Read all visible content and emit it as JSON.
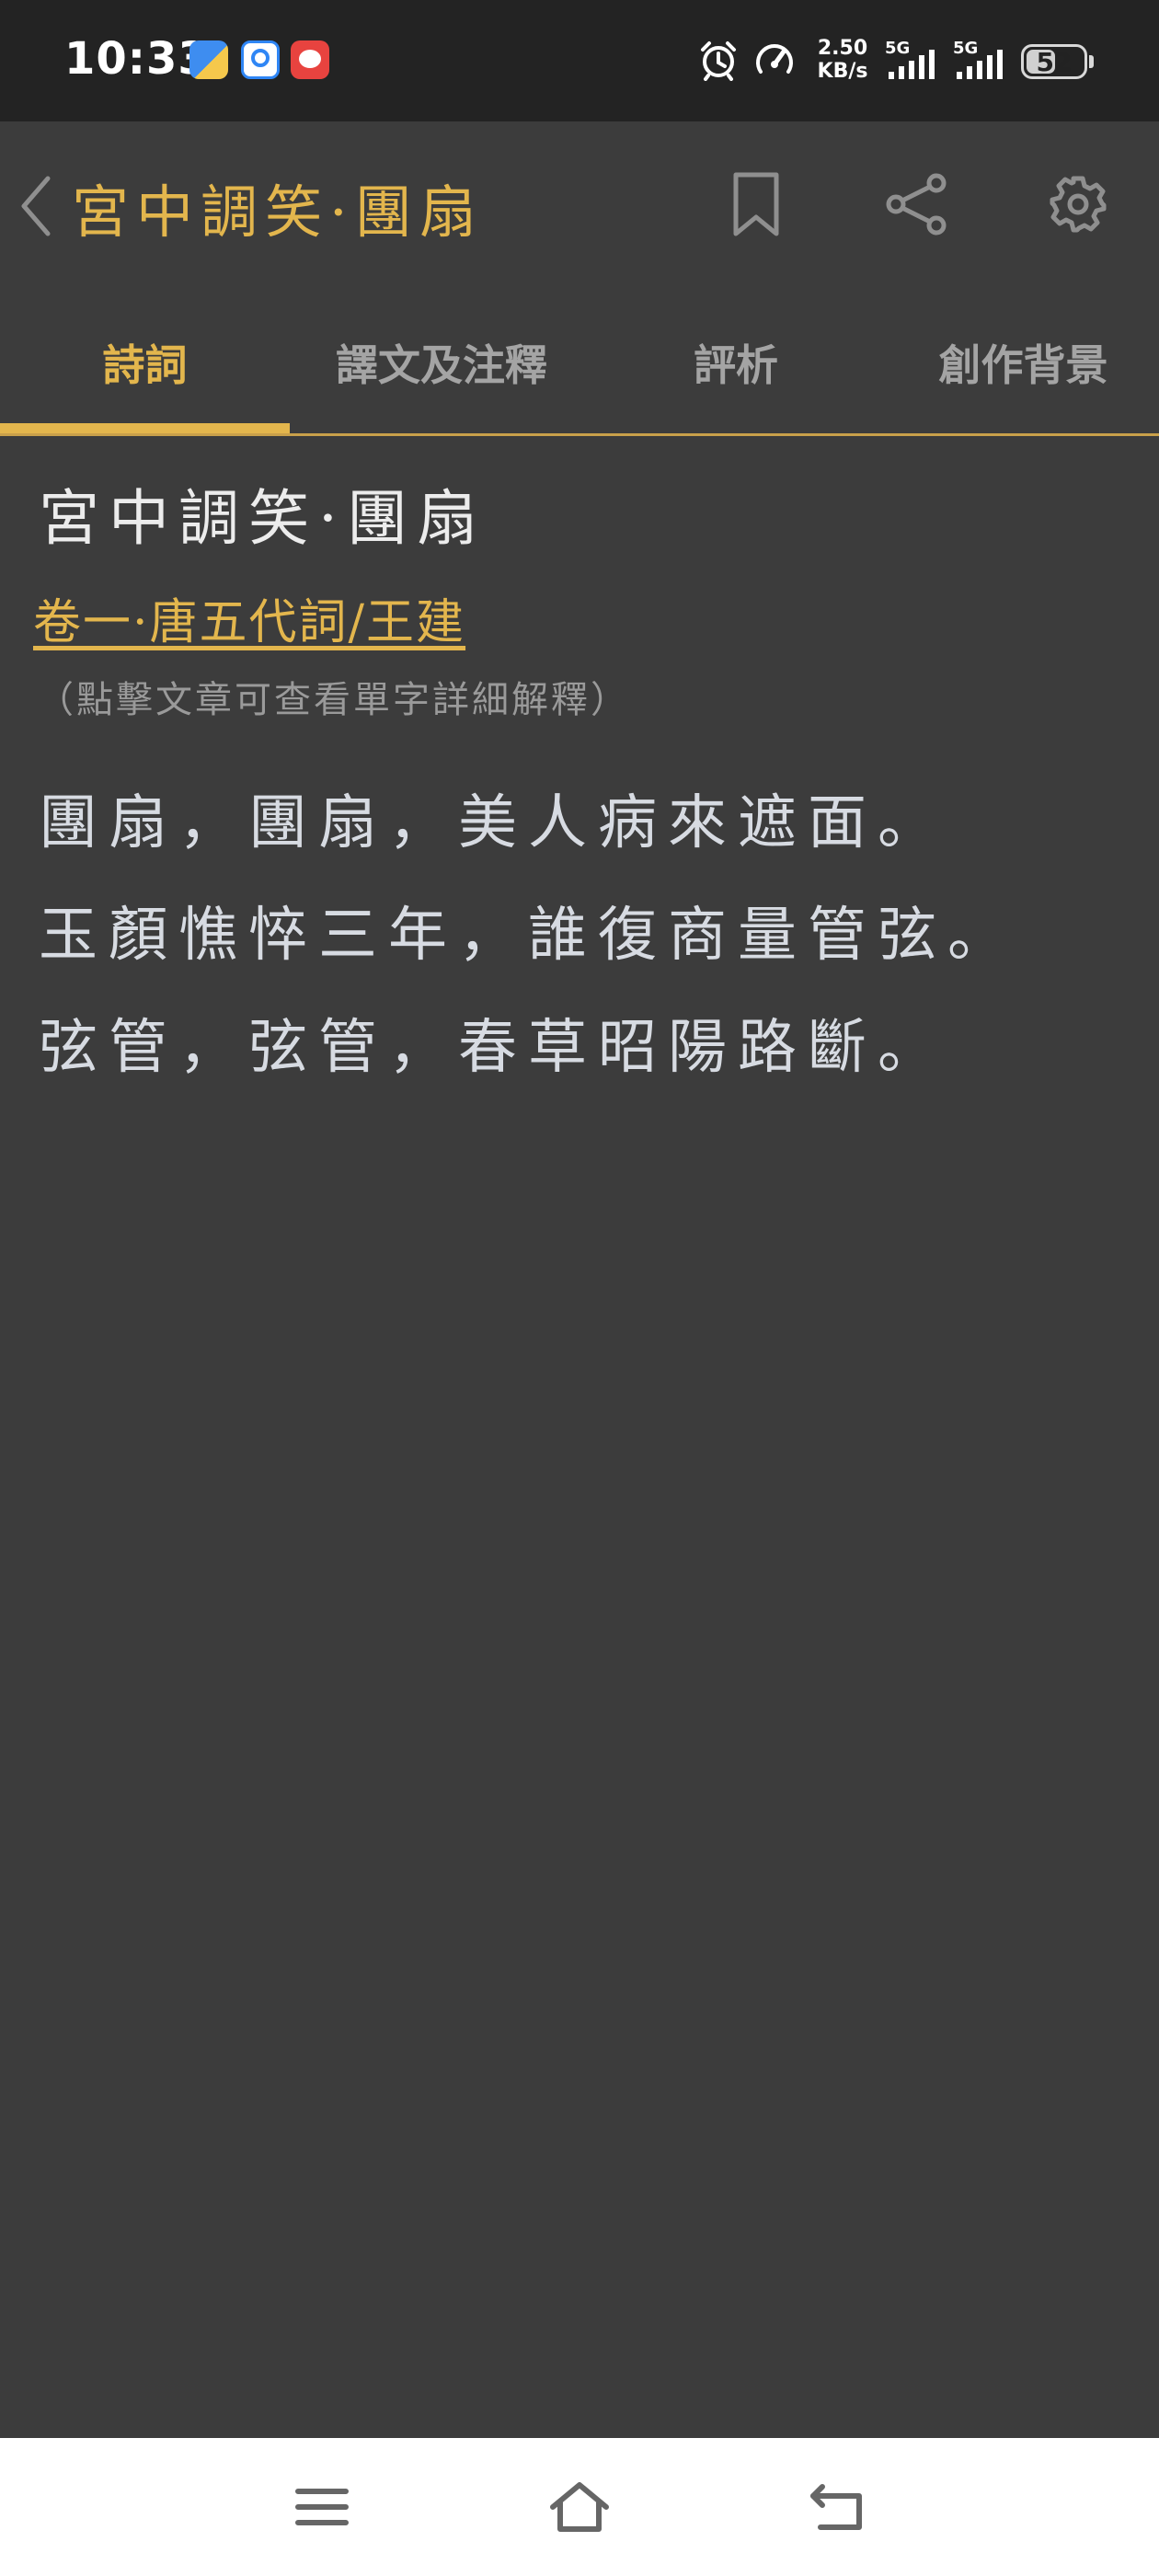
{
  "status_bar": {
    "time": "10:33",
    "network_speed_value": "2.50",
    "network_speed_unit": "KB/s",
    "signal_1_label": "5G",
    "signal_2_label": "5G",
    "battery_level": "52",
    "battery_fraction": 0.52,
    "icons": [
      "app-notification-icon",
      "app-notification-icon",
      "app-notification-icon",
      "alarm-icon",
      "speedometer-icon",
      "signal-icon",
      "signal-icon",
      "battery-icon"
    ]
  },
  "header": {
    "title": "宮中調笑·團扇",
    "icons": [
      "back-chevron-icon",
      "bookmark-icon",
      "share-icon",
      "gear-icon"
    ]
  },
  "tabs": [
    {
      "label": "詩詞",
      "active": true
    },
    {
      "label": "譯文及注釋",
      "active": false
    },
    {
      "label": "評析",
      "active": false
    },
    {
      "label": "創作背景",
      "active": false
    }
  ],
  "poem": {
    "title": "宮中調笑·團扇",
    "source": "卷一·唐五代詞/王建",
    "hint": "（點擊文章可查看單字詳細解釋）",
    "sentences": [
      "團扇，團扇，美人病來遮面。",
      "玉顏憔悴三年，誰復商量管弦。",
      "弦管，弦管，春草昭陽路斷。"
    ]
  },
  "nav_bar": {
    "icons": [
      "menu-icon",
      "home-icon",
      "back-icon"
    ]
  },
  "colors": {
    "accent": "#e3b64d",
    "background": "#3c3c3c",
    "status_bar": "#232323",
    "poem_text": "#d7dbe2",
    "tab_inactive": "#a4a4a4"
  }
}
